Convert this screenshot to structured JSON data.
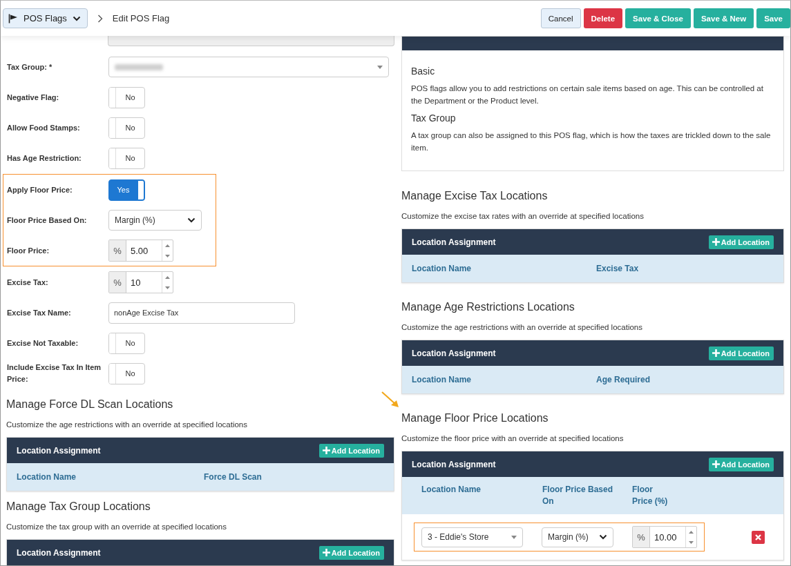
{
  "header": {
    "module_button": "POS Flags",
    "page_title": "Edit POS Flag",
    "actions": [
      {
        "label": "Cancel",
        "kind": "default"
      },
      {
        "label": "Delete",
        "kind": "danger"
      },
      {
        "label": "Save & Close",
        "kind": "success"
      },
      {
        "label": "Save & New",
        "kind": "success"
      },
      {
        "label": "Save",
        "kind": "success"
      }
    ]
  },
  "form": {
    "sections": [
      {
        "highlighted": false,
        "fields": [
          {
            "label": "Tax Group: *",
            "kind": "blurred-select"
          },
          {
            "label": "Negative Flag:",
            "kind": "toggle",
            "on": false,
            "value": "No"
          },
          {
            "label": "Allow Food Stamps:",
            "kind": "toggle",
            "on": false,
            "value": "No"
          },
          {
            "label": "Has Age Restriction:",
            "kind": "toggle",
            "on": false,
            "value": "No"
          }
        ]
      },
      {
        "highlighted": true,
        "fields": [
          {
            "label": "Apply Floor Price:",
            "kind": "toggle",
            "on": true,
            "value": "Yes"
          },
          {
            "label": "Floor Price Based On:",
            "kind": "select",
            "value": "Margin (%)"
          },
          {
            "label": "Floor Price:",
            "kind": "number",
            "unit": "%",
            "value": "5.00"
          }
        ]
      },
      {
        "highlighted": false,
        "fields": [
          {
            "label": "Excise Tax:",
            "kind": "number",
            "unit": "%",
            "value": "10"
          },
          {
            "label": "Excise Tax Name:",
            "kind": "text",
            "value": "nonAge Excise Tax"
          },
          {
            "label": "Excise Not Taxable:",
            "kind": "toggle",
            "on": false,
            "value": "No"
          },
          {
            "label": "Include Excise Tax In Item Price:",
            "kind": "toggle",
            "on": false,
            "value": "No"
          }
        ]
      }
    ]
  },
  "left_sections": [
    {
      "title": "Manage Force DL Scan Locations",
      "description": "Customize the age restrictions with an override at specified locations",
      "panel": {
        "title": "Location Assignment",
        "button": "Add Location",
        "columns": [
          "Location Name",
          "Force DL Scan"
        ]
      }
    },
    {
      "title": "Manage Tax Group Locations",
      "description": "Customize the tax group with an override at specified locations",
      "panel": {
        "title": "Location Assignment",
        "button": "Add Location"
      }
    }
  ],
  "information": {
    "topics": [
      {
        "heading": "Basic",
        "text": "POS flags allow you to add restrictions on certain sale items based on age. This can be controlled at the Department or the Product level."
      },
      {
        "heading": "Tax Group",
        "text": "A tax group can also be assigned to this POS flag, which is how the taxes are trickled down to the sale item."
      }
    ]
  },
  "right_sections": [
    {
      "title": "Manage Excise Tax Locations",
      "description": "Customize the excise tax rates with an override at specified locations",
      "panel": {
        "title": "Location Assignment",
        "button": "Add Location",
        "columns": [
          "Location Name",
          "Excise Tax"
        ]
      }
    },
    {
      "title": "Manage Age Restrictions Locations",
      "description": "Customize the age restrictions with an override at specified locations",
      "panel": {
        "title": "Location Assignment",
        "button": "Add Location",
        "columns": [
          "Location Name",
          "Age Required"
        ]
      }
    },
    {
      "title": "Manage Floor Price Locations",
      "description": "Customize the floor price with an override at specified locations",
      "pointer": true,
      "panel": {
        "title": "Location Assignment",
        "button": "Add Location",
        "columns": [
          "Location Name",
          "Floor Price Based On",
          "Floor Price (%)"
        ],
        "rows": [
          {
            "location": "3 - Eddie's Store",
            "based_on": "Margin (%)",
            "unit": "%",
            "value": "10.00",
            "highlighted": true
          }
        ]
      }
    }
  ]
}
